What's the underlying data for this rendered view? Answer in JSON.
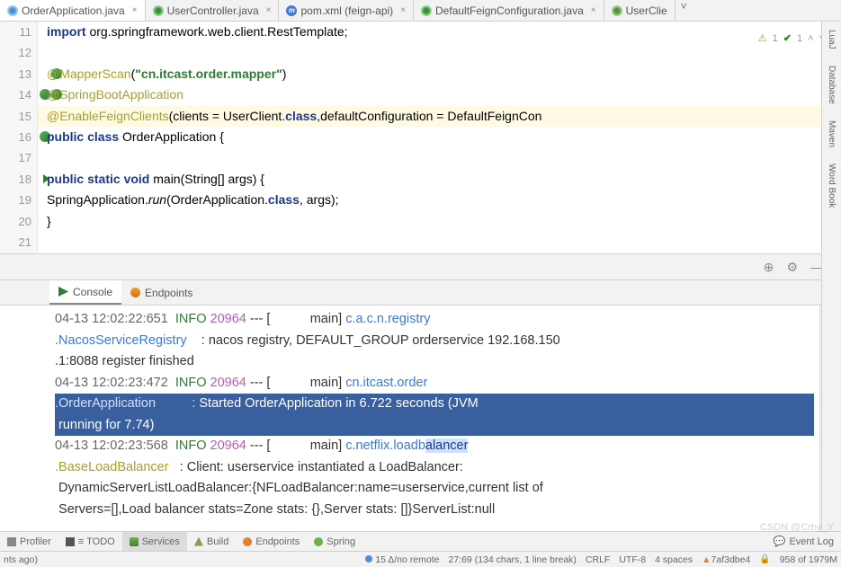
{
  "tabs": [
    {
      "label": "OrderApplication.java",
      "icon": "java",
      "active": true
    },
    {
      "label": "UserController.java",
      "icon": "class",
      "active": false
    },
    {
      "label": "pom.xml (feign-api)",
      "icon": "pom",
      "active": false
    },
    {
      "label": "DefaultFeignConfiguration.java",
      "icon": "class",
      "active": false
    },
    {
      "label": "UserClie",
      "icon": "int",
      "active": false,
      "partial": true
    }
  ],
  "inspect": {
    "warn": "1",
    "ok": "1"
  },
  "rightTools": [
    "LuaJ",
    "Database",
    "Maven",
    "Word Book"
  ],
  "code": {
    "lines": [
      {
        "n": "11",
        "parts": [
          {
            "t": "import ",
            "c": "kw"
          },
          {
            "t": "org.springframework.web.client.RestTemplate;"
          }
        ]
      },
      {
        "n": "12",
        "parts": []
      },
      {
        "n": "13",
        "mark": "green",
        "parts": [
          {
            "t": "@MapperScan",
            "c": "ann"
          },
          {
            "t": "("
          },
          {
            "t": "\"cn.itcast.order.mapper\"",
            "c": "str"
          },
          {
            "t": ")"
          }
        ]
      },
      {
        "n": "14",
        "mark": "dgreen",
        "parts": [
          {
            "t": "@SpringBootApplication",
            "c": "ann"
          }
        ]
      },
      {
        "n": "15",
        "mark": "green",
        "hl": true,
        "parts": [
          {
            "t": "@EnableFeignClients",
            "c": "ann"
          },
          {
            "t": "(clients = UserClient."
          },
          {
            "t": "class",
            "c": "kw"
          },
          {
            "t": ",defaultConfiguration = DefaultFeignCon"
          }
        ]
      },
      {
        "n": "16",
        "mark": "play",
        "parts": [
          {
            "t": "public class ",
            "c": "kw"
          },
          {
            "t": "OrderApplication {"
          }
        ]
      },
      {
        "n": "17",
        "parts": []
      },
      {
        "n": "18",
        "mark": "play1",
        "indent": 1,
        "parts": [
          {
            "t": "public static void ",
            "c": "kw"
          },
          {
            "t": "main(String[] args) {"
          }
        ]
      },
      {
        "n": "19",
        "indent": 2,
        "parts": [
          {
            "t": "SpringApplication."
          },
          {
            "t": "run",
            "c": "it"
          },
          {
            "t": "(OrderApplication."
          },
          {
            "t": "class",
            "c": "kw"
          },
          {
            "t": ", args);"
          }
        ]
      },
      {
        "n": "20",
        "indent": 1,
        "parts": [
          {
            "t": "}"
          }
        ]
      },
      {
        "n": "21",
        "parts": []
      }
    ]
  },
  "consoleTabs": [
    {
      "label": "Console",
      "icon": "play",
      "active": true
    },
    {
      "label": "Endpoints",
      "icon": "ep",
      "active": false
    }
  ],
  "console": [
    {
      "seg": [
        {
          "t": "04-13 12:02:22:651  ",
          "c": "ts"
        },
        {
          "t": "INFO ",
          "c": "lvl"
        },
        {
          "t": "20964",
          "c": "pid"
        },
        {
          "t": " --- [           main] "
        },
        {
          "t": "c.a.c.n.registry",
          "c": "logger"
        }
      ]
    },
    {
      "seg": [
        {
          "t": ".NacosServiceRegistry",
          "c": "logger"
        },
        {
          "t": "    : nacos registry, DEFAULT_GROUP orderservice 192.168.150"
        }
      ]
    },
    {
      "seg": [
        {
          "t": ".1:8088 register finished"
        }
      ]
    },
    {
      "seg": [
        {
          "t": "04-13 12:02:23:472  ",
          "c": "ts"
        },
        {
          "t": "INFO ",
          "c": "lvl"
        },
        {
          "t": "20964",
          "c": "pid"
        },
        {
          "t": " --- [           main] "
        },
        {
          "t": "cn.itcast.order",
          "c": "logger"
        }
      ]
    },
    {
      "sel": true,
      "seg": [
        {
          "t": ".OrderApplication",
          "c": "logger"
        },
        {
          "t": "          :"
        },
        {
          "t": " Started OrderApplication in 6.722 seconds (JVM ",
          "c": "selbody"
        }
      ]
    },
    {
      "sel": true,
      "seg": [
        {
          "t": " running for 7.74)",
          "c": "selbody"
        }
      ]
    },
    {
      "seg": [
        {
          "t": "04-13 12:02:23:568  ",
          "c": "ts"
        },
        {
          "t": "INFO ",
          "c": "lvl"
        },
        {
          "t": "20964",
          "c": "pid"
        },
        {
          "t": " --- [           main] "
        },
        {
          "t": "c.netflix.loadb",
          "c": "logger"
        },
        {
          "t": "alancer",
          "c": "partial"
        }
      ]
    },
    {
      "seg": [
        {
          "t": ".BaseLoadBalancer",
          "c": "logger2"
        },
        {
          "t": "   : Client: userservice instantiated a LoadBalancer:"
        }
      ]
    },
    {
      "seg": [
        {
          "t": " DynamicServerListLoadBalancer:{NFLoadBalancer:name=userservice,current list of"
        }
      ]
    },
    {
      "seg": [
        {
          "t": " Servers=[],Load balancer stats=Zone stats: {},Server stats: []}ServerList:null"
        }
      ]
    }
  ],
  "consoleRight": [
    "↘",
    "↑",
    "↓",
    "↕",
    "⬇",
    "⎙",
    "?"
  ],
  "bottomTabs": [
    {
      "label": "Profiler",
      "icon": "prof"
    },
    {
      "label": "TODO",
      "icon": "todo",
      "pre": "≡"
    },
    {
      "label": "Services",
      "icon": "serv",
      "active": true
    },
    {
      "label": "Build",
      "icon": "build"
    },
    {
      "label": "Endpoints",
      "icon": "ep2"
    },
    {
      "label": "Spring",
      "icon": "spring"
    }
  ],
  "eventLog": "Event Log",
  "status": {
    "left": "nts ago)",
    "git": "15 Δ/no remote",
    "pos": "27:69 (134 chars, 1 line break)",
    "eol": "CRLF",
    "enc": "UTF-8",
    "indent": "4 spaces",
    "branch": "7af3dbe4",
    "mem": "958 of 1979M"
  },
  "watermark": "CSDN @Crhy_Y"
}
